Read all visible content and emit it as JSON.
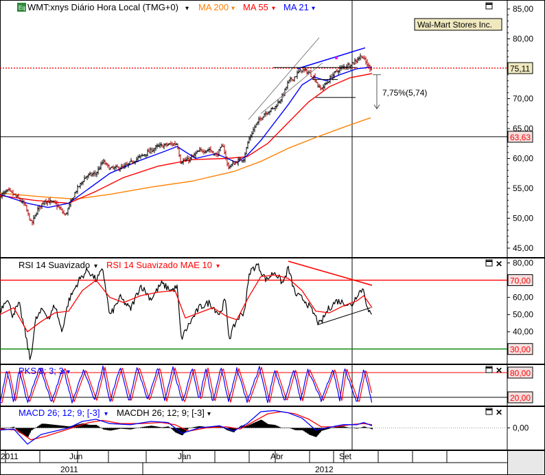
{
  "chart_data": {
    "type": "line",
    "title": "WMT:xnys Diário Hora Local (TMG+0)",
    "company_label": "Wal-Mart Stores Inc.",
    "colors": {
      "price": "#000000",
      "ma200": "#ff8000",
      "ma55": "#ff0000",
      "ma21": "#0000ff",
      "rsi_smoothed": "#000000",
      "rsi_mae": "#ff0000",
      "overbought_line": "#ff0000",
      "oversold_line": "#008000"
    },
    "legend": [
      {
        "label": "MA 200",
        "color": "#ff8000"
      },
      {
        "label": "MA 55",
        "color": "#ff0000"
      },
      {
        "label": "MA 21",
        "color": "#0000ff"
      }
    ],
    "x_axis": {
      "month_labels": [
        {
          "label": "2011",
          "t": 0
        },
        {
          "label": "Jun",
          "t": 100
        },
        {
          "label": "Jan",
          "t": 258
        },
        {
          "label": "Abr",
          "t": 393
        },
        {
          "label": "Set",
          "t": 493
        }
      ],
      "year_labels": [
        {
          "label": "2011",
          "t": 100
        },
        {
          "label": "2012",
          "t": 471
        }
      ],
      "crosshair_t": 513
    },
    "price_panel": {
      "y_ticks": [
        "85,00",
        "80,00",
        "75,00",
        "70,00",
        "65,00",
        "60,00",
        "55,00",
        "50,00",
        "45,00"
      ],
      "ylim": [
        43.5,
        86.5
      ],
      "current_value": 75.11,
      "current_label": "75,11",
      "horizontal_level": 63.63,
      "horizontal_label": "63,63",
      "pullback_annotation": "7,75%(5,74)",
      "pullback_from": 74.0,
      "pullback_to": 68.3,
      "ohlc_keypoints": [
        {
          "t": 0,
          "v": 53.8
        },
        {
          "t": 12,
          "v": 54.6
        },
        {
          "t": 25,
          "v": 53.5
        },
        {
          "t": 36,
          "v": 52.2
        },
        {
          "t": 46,
          "v": 49.0
        },
        {
          "t": 55,
          "v": 51.5
        },
        {
          "t": 65,
          "v": 53.0
        },
        {
          "t": 80,
          "v": 52.5
        },
        {
          "t": 95,
          "v": 50.5
        },
        {
          "t": 110,
          "v": 54.5
        },
        {
          "t": 125,
          "v": 57.0
        },
        {
          "t": 140,
          "v": 57.5
        },
        {
          "t": 150,
          "v": 59.5
        },
        {
          "t": 160,
          "v": 58.3
        },
        {
          "t": 180,
          "v": 58.5
        },
        {
          "t": 200,
          "v": 60.0
        },
        {
          "t": 215,
          "v": 61.0
        },
        {
          "t": 230,
          "v": 62.0
        },
        {
          "t": 245,
          "v": 62.3
        },
        {
          "t": 258,
          "v": 62.5
        },
        {
          "t": 263,
          "v": 59.5
        },
        {
          "t": 275,
          "v": 59.8
        },
        {
          "t": 290,
          "v": 61.2
        },
        {
          "t": 305,
          "v": 61.5
        },
        {
          "t": 315,
          "v": 60.5
        },
        {
          "t": 325,
          "v": 62.2
        },
        {
          "t": 332,
          "v": 58.5
        },
        {
          "t": 345,
          "v": 59.5
        },
        {
          "t": 355,
          "v": 60.0
        },
        {
          "t": 362,
          "v": 63.0
        },
        {
          "t": 372,
          "v": 65.5
        },
        {
          "t": 385,
          "v": 67.5
        },
        {
          "t": 400,
          "v": 68.5
        },
        {
          "t": 412,
          "v": 70.5
        },
        {
          "t": 420,
          "v": 72.8
        },
        {
          "t": 428,
          "v": 73.5
        },
        {
          "t": 438,
          "v": 74.8
        },
        {
          "t": 448,
          "v": 74.5
        },
        {
          "t": 458,
          "v": 73.5
        },
        {
          "t": 466,
          "v": 71.5
        },
        {
          "t": 475,
          "v": 72.5
        },
        {
          "t": 485,
          "v": 74.0
        },
        {
          "t": 495,
          "v": 75.0
        },
        {
          "t": 505,
          "v": 75.5
        },
        {
          "t": 515,
          "v": 76.0
        },
        {
          "t": 522,
          "v": 76.8
        },
        {
          "t": 527,
          "v": 77.2
        },
        {
          "t": 532,
          "v": 76.2
        },
        {
          "t": 538,
          "v": 75.2
        },
        {
          "t": 542,
          "v": 75.1
        }
      ],
      "ma21": [
        {
          "t": 0,
          "v": 54.0
        },
        {
          "t": 40,
          "v": 52.5
        },
        {
          "t": 70,
          "v": 51.8
        },
        {
          "t": 100,
          "v": 52.5
        },
        {
          "t": 130,
          "v": 55.0
        },
        {
          "t": 160,
          "v": 57.5
        },
        {
          "t": 200,
          "v": 59.5
        },
        {
          "t": 240,
          "v": 61.2
        },
        {
          "t": 258,
          "v": 62.0
        },
        {
          "t": 285,
          "v": 60.0
        },
        {
          "t": 315,
          "v": 60.8
        },
        {
          "t": 345,
          "v": 59.3
        },
        {
          "t": 360,
          "v": 60.5
        },
        {
          "t": 380,
          "v": 63.0
        },
        {
          "t": 400,
          "v": 66.0
        },
        {
          "t": 420,
          "v": 69.0
        },
        {
          "t": 440,
          "v": 72.3
        },
        {
          "t": 458,
          "v": 73.6
        },
        {
          "t": 475,
          "v": 73.0
        },
        {
          "t": 495,
          "v": 74.0
        },
        {
          "t": 520,
          "v": 75.0
        },
        {
          "t": 542,
          "v": 75.3
        }
      ],
      "ma55": [
        {
          "t": 0,
          "v": 53.8
        },
        {
          "t": 50,
          "v": 53.0
        },
        {
          "t": 100,
          "v": 52.5
        },
        {
          "t": 140,
          "v": 54.5
        },
        {
          "t": 180,
          "v": 56.8
        },
        {
          "t": 230,
          "v": 58.7
        },
        {
          "t": 280,
          "v": 59.8
        },
        {
          "t": 330,
          "v": 60.0
        },
        {
          "t": 360,
          "v": 60.3
        },
        {
          "t": 390,
          "v": 62.5
        },
        {
          "t": 420,
          "v": 66.0
        },
        {
          "t": 450,
          "v": 69.5
        },
        {
          "t": 480,
          "v": 72.0
        },
        {
          "t": 510,
          "v": 73.5
        },
        {
          "t": 542,
          "v": 74.2
        }
      ],
      "ma200": [
        {
          "t": 0,
          "v": 54.2
        },
        {
          "t": 60,
          "v": 53.6
        },
        {
          "t": 110,
          "v": 53.2
        },
        {
          "t": 160,
          "v": 54.0
        },
        {
          "t": 220,
          "v": 55.2
        },
        {
          "t": 280,
          "v": 56.2
        },
        {
          "t": 340,
          "v": 57.8
        },
        {
          "t": 380,
          "v": 59.5
        },
        {
          "t": 420,
          "v": 61.7
        },
        {
          "t": 460,
          "v": 63.5
        },
        {
          "t": 500,
          "v": 65.2
        },
        {
          "t": 540,
          "v": 66.8
        }
      ],
      "trendlines": [
        {
          "t1": 362,
          "v1": 66.5,
          "t2": 465,
          "v2": 80.2,
          "color": "#808080"
        },
        {
          "t1": 380,
          "v1": 67.5,
          "t2": 470,
          "v2": 76.0,
          "color": "#808080"
        },
        {
          "t1": 433,
          "v1": 75.0,
          "t2": 532,
          "v2": 78.5,
          "color": "#0000ff"
        },
        {
          "t1": 398,
          "v1": 75.2,
          "t2": 520,
          "v2": 75.2,
          "color": "#000000"
        },
        {
          "t1": 455,
          "v1": 73.2,
          "t2": 492,
          "v2": 73.2,
          "color": "#000000"
        },
        {
          "t1": 460,
          "v1": 70.2,
          "t2": 518,
          "v2": 70.2,
          "color": "#000000"
        }
      ]
    },
    "rsi_panel": {
      "title": "RSI 14 Suavizado",
      "mae_title": "RSI 14 Suavizado MAE 10",
      "y_ticks": [
        "80,00",
        "70,00",
        "60,00",
        "50,00",
        "40,00",
        "30,00"
      ],
      "ylim": [
        21.5,
        83.0
      ],
      "overbought": 70.0,
      "overbought_label": "70,00",
      "oversold": 30.0,
      "oversold_label": "30,00",
      "rsi": [
        {
          "t": 0,
          "v": 52
        },
        {
          "t": 10,
          "v": 60
        },
        {
          "t": 18,
          "v": 50
        },
        {
          "t": 28,
          "v": 56
        },
        {
          "t": 38,
          "v": 37
        },
        {
          "t": 44,
          "v": 23
        },
        {
          "t": 52,
          "v": 47
        },
        {
          "t": 62,
          "v": 53
        },
        {
          "t": 72,
          "v": 48
        },
        {
          "t": 80,
          "v": 56
        },
        {
          "t": 90,
          "v": 40
        },
        {
          "t": 100,
          "v": 58
        },
        {
          "t": 115,
          "v": 70
        },
        {
          "t": 128,
          "v": 76
        },
        {
          "t": 140,
          "v": 70
        },
        {
          "t": 150,
          "v": 76
        },
        {
          "t": 160,
          "v": 49
        },
        {
          "t": 175,
          "v": 60
        },
        {
          "t": 190,
          "v": 53
        },
        {
          "t": 205,
          "v": 67
        },
        {
          "t": 220,
          "v": 59
        },
        {
          "t": 235,
          "v": 68
        },
        {
          "t": 250,
          "v": 64
        },
        {
          "t": 258,
          "v": 66
        },
        {
          "t": 264,
          "v": 36
        },
        {
          "t": 275,
          "v": 44
        },
        {
          "t": 290,
          "v": 54
        },
        {
          "t": 305,
          "v": 57
        },
        {
          "t": 320,
          "v": 50
        },
        {
          "t": 328,
          "v": 59
        },
        {
          "t": 334,
          "v": 36
        },
        {
          "t": 345,
          "v": 47
        },
        {
          "t": 356,
          "v": 52
        },
        {
          "t": 364,
          "v": 75
        },
        {
          "t": 375,
          "v": 79
        },
        {
          "t": 388,
          "v": 70
        },
        {
          "t": 400,
          "v": 75
        },
        {
          "t": 412,
          "v": 68
        },
        {
          "t": 420,
          "v": 77
        },
        {
          "t": 430,
          "v": 62
        },
        {
          "t": 445,
          "v": 58
        },
        {
          "t": 458,
          "v": 50
        },
        {
          "t": 466,
          "v": 44
        },
        {
          "t": 478,
          "v": 53
        },
        {
          "t": 490,
          "v": 58
        },
        {
          "t": 502,
          "v": 57
        },
        {
          "t": 512,
          "v": 55
        },
        {
          "t": 522,
          "v": 63
        },
        {
          "t": 530,
          "v": 65
        },
        {
          "t": 536,
          "v": 52
        },
        {
          "t": 542,
          "v": 49
        }
      ],
      "rsi_mae": [
        {
          "t": 0,
          "v": 50
        },
        {
          "t": 20,
          "v": 54
        },
        {
          "t": 40,
          "v": 40
        },
        {
          "t": 60,
          "v": 46
        },
        {
          "t": 80,
          "v": 51
        },
        {
          "t": 100,
          "v": 52
        },
        {
          "t": 120,
          "v": 64
        },
        {
          "t": 140,
          "v": 70
        },
        {
          "t": 160,
          "v": 60
        },
        {
          "t": 180,
          "v": 57
        },
        {
          "t": 205,
          "v": 61
        },
        {
          "t": 230,
          "v": 63
        },
        {
          "t": 255,
          "v": 64
        },
        {
          "t": 270,
          "v": 48
        },
        {
          "t": 290,
          "v": 51
        },
        {
          "t": 310,
          "v": 54
        },
        {
          "t": 330,
          "v": 49
        },
        {
          "t": 345,
          "v": 47
        },
        {
          "t": 362,
          "v": 60
        },
        {
          "t": 380,
          "v": 72
        },
        {
          "t": 400,
          "v": 73
        },
        {
          "t": 420,
          "v": 71
        },
        {
          "t": 440,
          "v": 64
        },
        {
          "t": 460,
          "v": 52
        },
        {
          "t": 480,
          "v": 51
        },
        {
          "t": 500,
          "v": 55
        },
        {
          "t": 520,
          "v": 58
        },
        {
          "t": 530,
          "v": 61
        },
        {
          "t": 542,
          "v": 54
        }
      ],
      "trendlines": [
        {
          "t1": 420,
          "v1": 81,
          "t2": 542,
          "v2": 67,
          "color": "#ff0000"
        },
        {
          "t1": 462,
          "v1": 44,
          "t2": 540,
          "v2": 54,
          "color": "#000000"
        }
      ]
    },
    "pks_panel": {
      "title": "PKS 8; 3; 3",
      "y_ticks": [
        "80,00",
        "20,00"
      ],
      "ylim": [
        0,
        100
      ],
      "upper": 80.0,
      "upper_label": "80,00",
      "lower": 20.0,
      "lower_label": "20,00",
      "cycle_peaks_t": [
        10,
        28,
        58,
        92,
        122,
        150,
        175,
        200,
        230,
        252,
        280,
        300,
        322,
        345,
        378,
        400,
        428,
        448,
        485,
        502,
        530
      ],
      "cycle_troughs_t": [
        0,
        20,
        40,
        75,
        105,
        138,
        160,
        188,
        215,
        240,
        266,
        290,
        310,
        333,
        360,
        390,
        415,
        438,
        468,
        495,
        520,
        542
      ]
    },
    "macd_panel": {
      "title": "MACD 26; 12; 9; [-3]",
      "hist_title": "MACDH 26; 12; 9; [-3]",
      "y_ticks": [
        "0,00"
      ],
      "ylim": [
        -2.0,
        2.0
      ],
      "macd": [
        {
          "t": 0,
          "v": -0.2
        },
        {
          "t": 20,
          "v": -0.1
        },
        {
          "t": 40,
          "v": -1.5
        },
        {
          "t": 60,
          "v": -0.6
        },
        {
          "t": 80,
          "v": -0.3
        },
        {
          "t": 100,
          "v": 0.0
        },
        {
          "t": 120,
          "v": 0.6
        },
        {
          "t": 140,
          "v": 0.8
        },
        {
          "t": 160,
          "v": 0.4
        },
        {
          "t": 190,
          "v": 0.3
        },
        {
          "t": 220,
          "v": 0.6
        },
        {
          "t": 245,
          "v": 0.5
        },
        {
          "t": 265,
          "v": -0.5
        },
        {
          "t": 290,
          "v": 0.0
        },
        {
          "t": 320,
          "v": 0.2
        },
        {
          "t": 340,
          "v": -0.3
        },
        {
          "t": 360,
          "v": 0.4
        },
        {
          "t": 380,
          "v": 1.5
        },
        {
          "t": 400,
          "v": 1.6
        },
        {
          "t": 420,
          "v": 1.4
        },
        {
          "t": 440,
          "v": 0.9
        },
        {
          "t": 460,
          "v": -0.2
        },
        {
          "t": 475,
          "v": 0.0
        },
        {
          "t": 500,
          "v": 0.3
        },
        {
          "t": 520,
          "v": 0.3
        },
        {
          "t": 530,
          "v": 0.5
        },
        {
          "t": 542,
          "v": 0.2
        }
      ],
      "signal": [
        {
          "t": 0,
          "v": -0.1
        },
        {
          "t": 25,
          "v": -0.2
        },
        {
          "t": 45,
          "v": -1.1
        },
        {
          "t": 65,
          "v": -0.8
        },
        {
          "t": 90,
          "v": -0.3
        },
        {
          "t": 110,
          "v": 0.1
        },
        {
          "t": 130,
          "v": 0.5
        },
        {
          "t": 150,
          "v": 0.7
        },
        {
          "t": 175,
          "v": 0.4
        },
        {
          "t": 205,
          "v": 0.4
        },
        {
          "t": 235,
          "v": 0.5
        },
        {
          "t": 255,
          "v": 0.3
        },
        {
          "t": 275,
          "v": -0.3
        },
        {
          "t": 300,
          "v": 0.0
        },
        {
          "t": 330,
          "v": 0.1
        },
        {
          "t": 350,
          "v": -0.1
        },
        {
          "t": 370,
          "v": 0.6
        },
        {
          "t": 390,
          "v": 1.3
        },
        {
          "t": 410,
          "v": 1.5
        },
        {
          "t": 430,
          "v": 1.3
        },
        {
          "t": 450,
          "v": 0.8
        },
        {
          "t": 468,
          "v": 0.1
        },
        {
          "t": 490,
          "v": 0.1
        },
        {
          "t": 510,
          "v": 0.3
        },
        {
          "t": 530,
          "v": 0.4
        },
        {
          "t": 542,
          "v": 0.3
        }
      ]
    }
  }
}
